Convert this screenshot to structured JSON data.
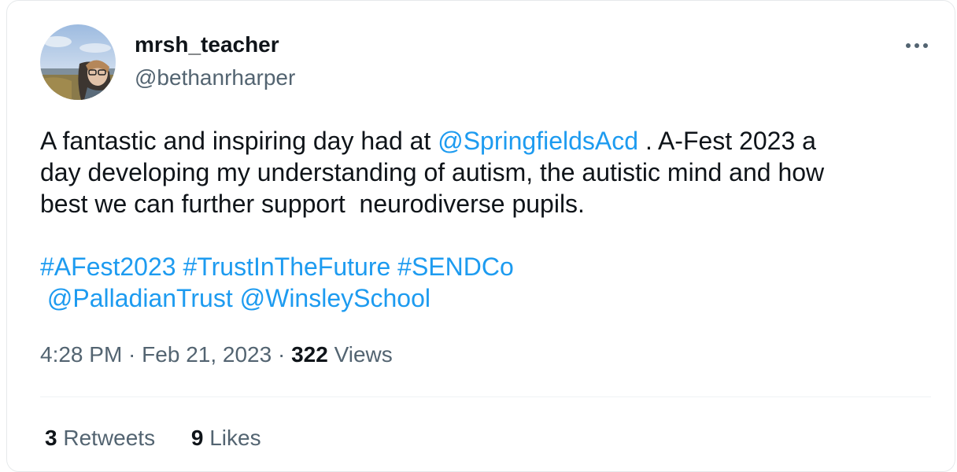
{
  "author": {
    "display_name": "mrsh_teacher",
    "handle": "@bethanrharper"
  },
  "icons": {
    "more": "more-horizontal-icon",
    "avatar": "profile-photo"
  },
  "colors": {
    "link": "#1d9bf0",
    "text": "#0f1419",
    "secondary": "#536471"
  },
  "tweet": {
    "line1_prefix": "A fantastic and inspiring day had at ",
    "mention_springfields": "@SpringfieldsAcd",
    "line1_suffix": " . A-Fest 2023 a",
    "line2": "day developing my understanding of autism, the autistic mind and how",
    "line3": "best we can further support  neurodiverse pupils.",
    "hashtag_afest": "#AFest2023",
    "hashtag_trust": "#TrustInTheFuture",
    "hashtag_sendco": "#SENDCo",
    "mention_palladian": "@PalladianTrust",
    "mention_winsley": "@WinsleySchool"
  },
  "meta": {
    "time": "4:28 PM",
    "separator": " · ",
    "date": "Feb 21, 2023",
    "views_count": "322",
    "views_label": " Views"
  },
  "stats": {
    "retweets_count": "3",
    "retweets_label": " Retweets",
    "likes_count": "9",
    "likes_label": " Likes"
  }
}
